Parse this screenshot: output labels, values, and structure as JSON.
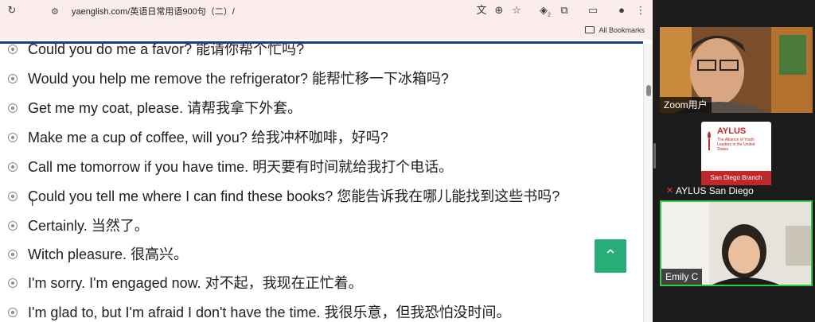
{
  "browser": {
    "url": "yaenglish.com/英语日常用语900句（二）/",
    "bookmarks_folder_label": "All Bookmarks",
    "extensions_badge": "2",
    "icons": [
      "reload-icon",
      "site-info-icon",
      "translate-icon",
      "zoom-icon",
      "star-icon",
      "extension-icon",
      "puzzle-icon",
      "cast-icon",
      "profile-icon",
      "menu-icon"
    ]
  },
  "phrases": [
    {
      "text": "Could you do me a favor? 能请你帮个忙吗?"
    },
    {
      "text": "Would you help me remove the refrigerator? 能帮忙移一下冰箱吗?"
    },
    {
      "text": "Get me my coat, please. 请帮我拿下外套。"
    },
    {
      "text": "Make me a cup of coffee, will you? 给我冲杯咖啡，好吗?"
    },
    {
      "text": "Call me tomorrow if you have time. 明天要有时间就给我打个电话。"
    },
    {
      "text": "Could you tell me where I can find these books? 您能告诉我在哪儿能找到这些书吗?"
    },
    {
      "text": "Certainly. 当然了。"
    },
    {
      "text": "Witch pleasure. 很高兴。"
    },
    {
      "text": "I'm sorry. I'm engaged now. 对不起，我现在正忙着。"
    },
    {
      "text": "I'm glad to, but I'm afraid I don't have the time. 我很乐意，但我恐怕没时间。"
    }
  ],
  "back_to_top": {
    "icon": "chevron-up-icon",
    "glyph": "➜"
  },
  "zoom": {
    "participants": [
      {
        "name": "Zoom用户",
        "video": "camera-on"
      },
      {
        "name": "AYLUS San Diego",
        "video": "logo",
        "muted": true
      },
      {
        "name": "Emily C",
        "video": "camera-on",
        "active_speaker": true
      }
    ],
    "aylus_logo": {
      "title": "AYLUS",
      "subtitle": "The Alliance of Youth Leaders in the United States",
      "branch": "San Diego Branch"
    }
  },
  "colors": {
    "toolbar": "#fbeded",
    "page_rule": "#1a3c8e",
    "back_to_top": "#27ae78",
    "active_speaker_border": "#2ecc40",
    "aylus_red": "#c0282a"
  }
}
